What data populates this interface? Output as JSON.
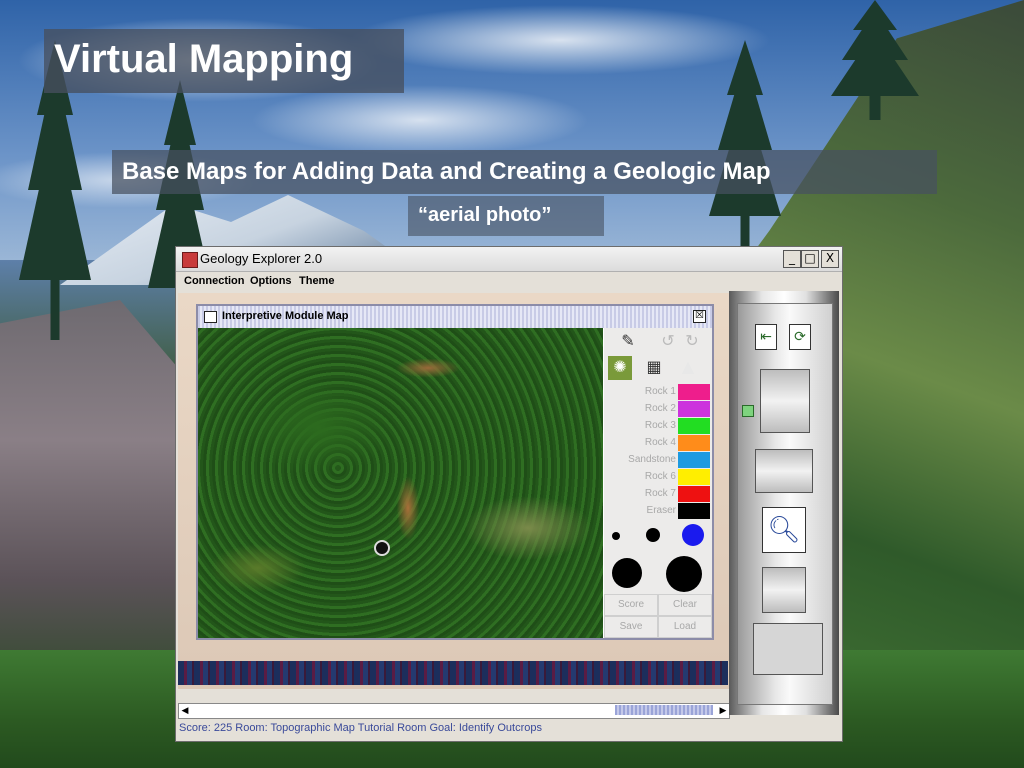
{
  "slide": {
    "title": "Virtual Mapping",
    "subtitle": "Base Maps for Adding Data and Creating a Geologic Map",
    "caption": "“aerial photo”"
  },
  "window": {
    "title": "Geology Explorer 2.0",
    "controls": {
      "minimize": "_",
      "maximize": "□",
      "close": "X"
    },
    "menu": [
      "Connection",
      "Options",
      "Theme"
    ],
    "status": "Score: 225    Room: Topographic Map Tutorial Room    Goal: Identify Outcrops"
  },
  "internal_window": {
    "title": "Interpretive Module Map",
    "close": "☒"
  },
  "tools": {
    "rocks": [
      {
        "label": "Rock 1",
        "color": "#ee1e8c"
      },
      {
        "label": "Rock 2",
        "color": "#cc33dd"
      },
      {
        "label": "Rock 3",
        "color": "#22dd22"
      },
      {
        "label": "Rock 4",
        "color": "#ff8c1a"
      },
      {
        "label": "Sandstone",
        "color": "#1e9ae0"
      },
      {
        "label": "Rock 6",
        "color": "#ffee00"
      },
      {
        "label": "Rock 7",
        "color": "#ee1111"
      },
      {
        "label": "Eraser",
        "color": "#000000"
      }
    ],
    "buttons": {
      "score": "Score",
      "clear": "Clear",
      "save": "Save",
      "load": "Load"
    }
  }
}
